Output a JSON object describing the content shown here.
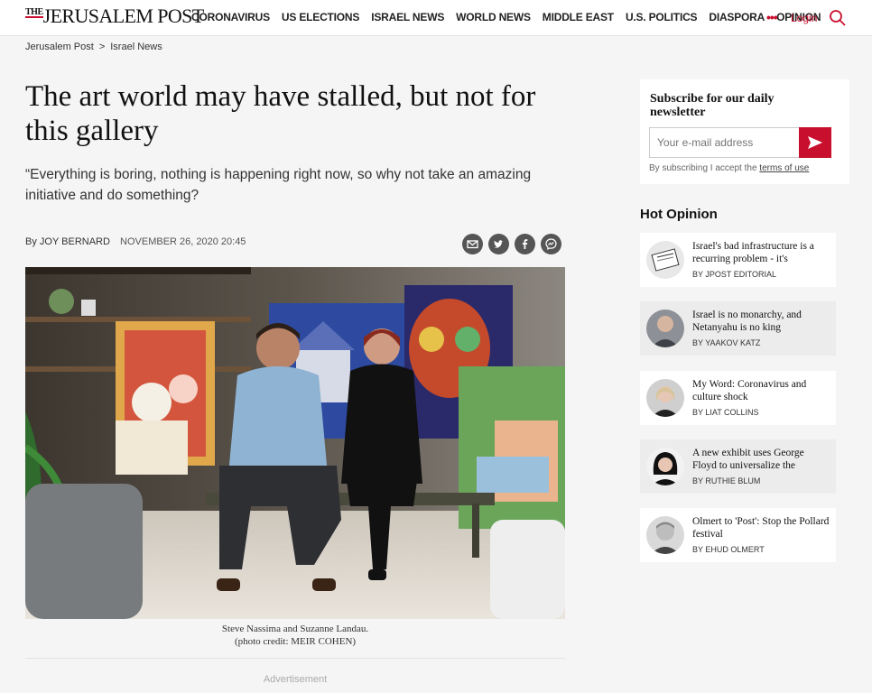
{
  "header": {
    "logo_the": "THE",
    "logo_name": "JERUSALEM POST",
    "nav": [
      "CORONAVIRUS",
      "US ELECTIONS",
      "ISRAEL NEWS",
      "WORLD NEWS",
      "MIDDLE EAST",
      "U.S. POLITICS",
      "DIASPORA",
      "OPINION"
    ],
    "more": "•••",
    "login": "Login",
    "accent": "#c8102e"
  },
  "breadcrumb": {
    "home": "Jerusalem Post",
    "sep": ">",
    "section": "Israel News"
  },
  "article": {
    "headline": "The art world may have stalled, but not for this gallery",
    "subhead": "“Everything is boring, nothing is happening right now, so why not take an amazing initiative and do something?",
    "by": "By",
    "author": "Joy Bernard",
    "date": "November 26, 2020 20:45",
    "caption_line1": "Steve Nassima and Suzanne Landau.",
    "caption_line2": "(photo credit: MEIR COHEN)",
    "advertisement": "Advertisement"
  },
  "share_icons": [
    "email-icon",
    "twitter-icon",
    "facebook-icon",
    "messenger-icon"
  ],
  "newsletter": {
    "title": "Subscribe for our daily newsletter",
    "placeholder": "Your e-mail address",
    "terms_prefix": "By subscribing I accept the",
    "terms_link": "terms of use"
  },
  "hot_opinion": {
    "title": "Hot Opinion",
    "items": [
      {
        "title": "Israel's bad infrastructure is a recurring problem - it's",
        "by": "By",
        "author": "Jpost Editorial"
      },
      {
        "title": "Israel is no monarchy, and Netanyahu is no king",
        "by": "By",
        "author": "Yaakov Katz"
      },
      {
        "title": "My Word: Coronavirus and culture shock",
        "by": "By",
        "author": "Liat Collins"
      },
      {
        "title": "A new exhibit uses George Floyd to universalize the",
        "by": "By",
        "author": "Ruthie Blum"
      },
      {
        "title": "Olmert to 'Post': Stop the Pollard festival",
        "by": "By",
        "author": "Ehud Olmert"
      }
    ]
  }
}
